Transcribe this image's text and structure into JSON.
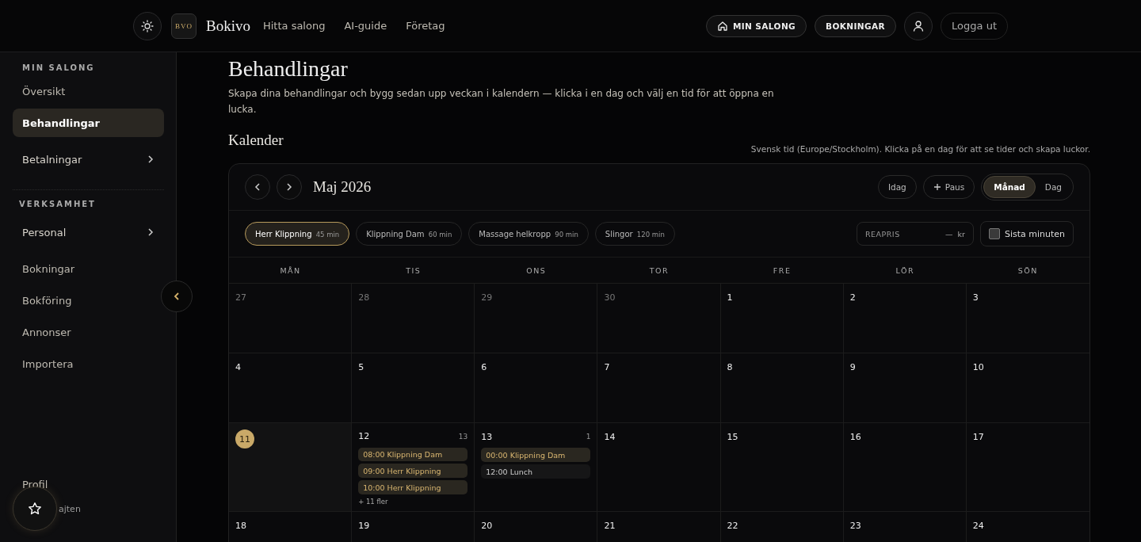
{
  "header": {
    "brand_mark": "BVO",
    "brand": "Bokivo",
    "nav": [
      "Hitta salong",
      "AI-guide",
      "Företag"
    ],
    "actions": [
      {
        "label": "MIN SALONG",
        "kind": "home"
      },
      {
        "label": "BOKNINGAR",
        "kind": "plain"
      }
    ],
    "logout": "Logga ut"
  },
  "sidebar": {
    "sections": [
      {
        "title": "MIN SALONG",
        "items": [
          {
            "label": "Översikt",
            "selected": false,
            "submenu": false
          },
          {
            "label": "Behandlingar",
            "selected": true,
            "submenu": false
          },
          {
            "label": "Betalningar",
            "selected": false,
            "submenu": true
          }
        ]
      },
      {
        "title": "VERKSAMHET",
        "items": [
          {
            "label": "Personal",
            "selected": false,
            "submenu": true
          },
          {
            "label": "Bokningar",
            "selected": false,
            "submenu": false
          },
          {
            "label": "Bokföring",
            "selected": false,
            "submenu": false
          },
          {
            "label": "Annonser",
            "selected": false,
            "submenu": false
          },
          {
            "label": "Importera",
            "selected": false,
            "submenu": false
          }
        ]
      }
    ],
    "footer_items": [
      "Profil",
      "ajten"
    ]
  },
  "page": {
    "title": "Behandlingar",
    "description": "Skapa dina behandlingar och bygg sedan upp veckan i kalendern — klicka i en dag och välj en tid för att öppna en lucka.",
    "calendar_heading": "Kalender",
    "timezone_note": "Svensk tid (Europe/Stockholm). Klicka på en dag för att se tider och skapa luckor."
  },
  "calendar": {
    "month": "Maj 2026",
    "today_button": "Idag",
    "pause_button": "Paus",
    "views": [
      {
        "label": "Månad",
        "selected": true
      },
      {
        "label": "Dag",
        "selected": false
      }
    ],
    "services": [
      {
        "name": "Herr Klippning",
        "duration": "45 min",
        "selected": true
      },
      {
        "name": "Klippning Dam",
        "duration": "60 min",
        "selected": false
      },
      {
        "name": "Massage helkropp",
        "duration": "90 min",
        "selected": false
      },
      {
        "name": "Slingor",
        "duration": "120 min",
        "selected": false
      }
    ],
    "sale_price": {
      "placeholder": "REAPRIS",
      "value": "—",
      "unit": "kr"
    },
    "last_minute": {
      "label": "Sista minuten",
      "checked": false
    },
    "weekdays": [
      "MÅN",
      "TIS",
      "ONS",
      "TOR",
      "FRE",
      "LÖR",
      "SÖN"
    ],
    "weeks": [
      [
        {
          "day": "27",
          "muted": true,
          "today": false
        },
        {
          "day": "28",
          "muted": true,
          "today": false
        },
        {
          "day": "29",
          "muted": true,
          "today": false
        },
        {
          "day": "30",
          "muted": true,
          "today": false
        },
        {
          "day": "1",
          "muted": false,
          "today": false
        },
        {
          "day": "2",
          "muted": false,
          "today": false
        },
        {
          "day": "3",
          "muted": false,
          "today": false
        }
      ],
      [
        {
          "day": "4",
          "muted": false,
          "today": false
        },
        {
          "day": "5",
          "muted": false,
          "today": false
        },
        {
          "day": "6",
          "muted": false,
          "today": false
        },
        {
          "day": "7",
          "muted": false,
          "today": false
        },
        {
          "day": "8",
          "muted": false,
          "today": false
        },
        {
          "day": "9",
          "muted": false,
          "today": false
        },
        {
          "day": "10",
          "muted": false,
          "today": false
        }
      ],
      [
        {
          "day": "11",
          "muted": false,
          "today": true
        },
        {
          "day": "12",
          "muted": false,
          "today": false,
          "count": "13",
          "events": [
            {
              "kind": "booking",
              "text": "08:00 Klippning Dam"
            },
            {
              "kind": "booking",
              "text": "09:00 Herr Klippning"
            },
            {
              "kind": "booking",
              "text": "10:00 Herr Klippning"
            }
          ],
          "more": "+ 11 fler"
        },
        {
          "day": "13",
          "muted": false,
          "today": false,
          "count": "1",
          "events": [
            {
              "kind": "booking",
              "text": "00:00 Klippning Dam"
            },
            {
              "kind": "break",
              "text": "12:00 Lunch"
            }
          ]
        },
        {
          "day": "14",
          "muted": false,
          "today": false
        },
        {
          "day": "15",
          "muted": false,
          "today": false
        },
        {
          "day": "16",
          "muted": false,
          "today": false
        },
        {
          "day": "17",
          "muted": false,
          "today": false
        }
      ],
      [
        {
          "day": "18",
          "muted": false,
          "today": false
        },
        {
          "day": "19",
          "muted": false,
          "today": false
        },
        {
          "day": "20",
          "muted": false,
          "today": false
        },
        {
          "day": "21",
          "muted": false,
          "today": false
        },
        {
          "day": "22",
          "muted": false,
          "today": false
        },
        {
          "day": "23",
          "muted": false,
          "today": false
        },
        {
          "day": "24",
          "muted": false,
          "today": false
        }
      ]
    ]
  }
}
